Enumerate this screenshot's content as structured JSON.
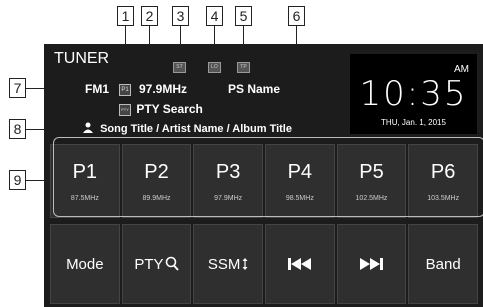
{
  "tuner": {
    "mode": "TUNER",
    "band": "FM1",
    "preset_badge": "P1",
    "frequency": "97.9MHz",
    "ps_name": "PS Name",
    "pty_badge": "PTY",
    "pty_search": "PTY Search",
    "radio_text": "Song Title / Artist Name / Album Title",
    "indicators": [
      "ST",
      "LO",
      "TP"
    ]
  },
  "clock": {
    "ampm": "AM",
    "time": "10:35",
    "date": "THU, Jan. 1, 2015"
  },
  "presets": [
    {
      "label": "P1",
      "freq": "87.5MHz"
    },
    {
      "label": "P2",
      "freq": "89.9MHz"
    },
    {
      "label": "P3",
      "freq": "97.9MHz"
    },
    {
      "label": "P4",
      "freq": "98.5MHz"
    },
    {
      "label": "P5",
      "freq": "102.5MHz"
    },
    {
      "label": "P6",
      "freq": "103.5MHz"
    }
  ],
  "buttons": {
    "mode": "Mode",
    "pty": "PTY",
    "ssm": "SSM",
    "band": "Band"
  },
  "icons": {
    "pty": "magnifier-icon",
    "ssm": "up-down-arrow-icon",
    "prev": "skip-previous-icon",
    "next": "skip-next-icon",
    "radio_text": "person-icon"
  },
  "callouts": [
    "1",
    "2",
    "3",
    "4",
    "5",
    "6",
    "7",
    "8",
    "9"
  ]
}
